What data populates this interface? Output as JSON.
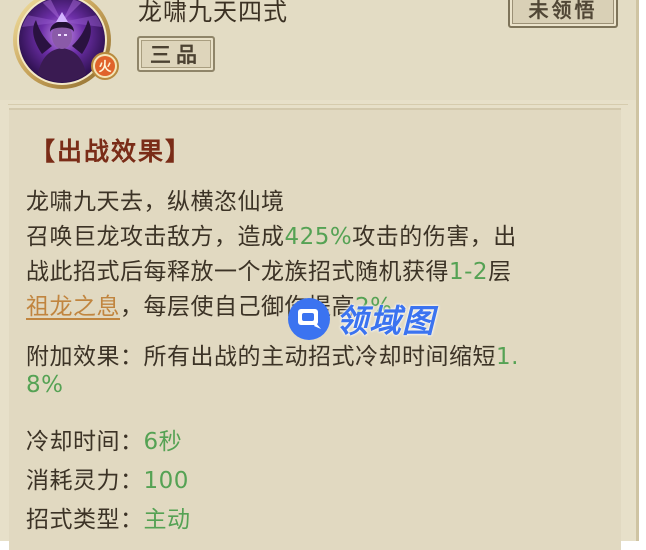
{
  "skill": {
    "name": "龙啸九天四式",
    "grade": "三品",
    "status": "未领悟",
    "element": "火"
  },
  "section_title": "【出战效果】",
  "description": {
    "line1": "龙啸九天去，纵横恣仙境",
    "line2_pre": "召唤巨龙攻击敌方，造成",
    "line2_val": "425%",
    "line2_post": "攻击的伤害，出",
    "line3_pre": "战此招式后每释放一个龙族招式随机获得",
    "line3_val": "1-2",
    "line3_post": "层",
    "line4_link": "祖龙之息",
    "line4_mid": "，每层使自己御伤提高",
    "line4_val": "2%"
  },
  "extra": {
    "label": "附加效果：",
    "text": "所有出战的主动招式冷却时间缩短",
    "val_part1": "1.",
    "val_part2": "8%"
  },
  "stats": {
    "cooldown_label": "冷却时间：",
    "cooldown_value": "6秒",
    "cost_label": "消耗灵力：",
    "cost_value": "100",
    "type_label": "招式类型：",
    "type_value": "主动"
  },
  "watermark": {
    "text": "领域图"
  },
  "colors": {
    "panel": "#e7e0c9",
    "title_red": "#7a2c17",
    "value_green": "#55a254",
    "link_orange": "#c1853f",
    "watermark_blue": "#3b73f0"
  },
  "icons": {
    "avatar": "dragon-warrior-portrait",
    "element_badge": "fire-element-badge",
    "watermark_logo": "chat-bubble-logo"
  }
}
